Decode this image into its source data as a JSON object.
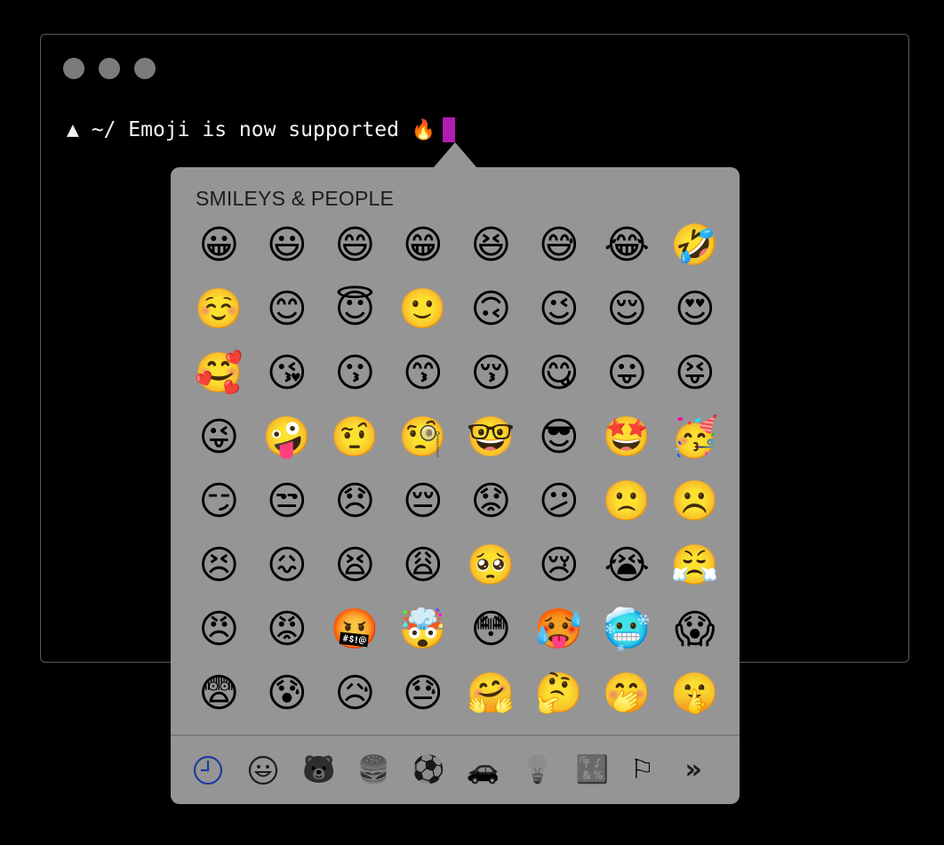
{
  "terminal": {
    "prompt_symbol": "▲",
    "path": "~/",
    "text": "Emoji is now supported",
    "text_emoji": "🔥",
    "cursor_color": "#b21cb3"
  },
  "picker": {
    "section_title": "SMILEYS & PEOPLE",
    "emojis": [
      "😀",
      "😃",
      "😄",
      "😁",
      "😆",
      "😅",
      "😂",
      "🤣",
      "☺️",
      "😊",
      "😇",
      "🙂",
      "🙃",
      "😉",
      "😌",
      "😍",
      "🥰",
      "😘",
      "😗",
      "😙",
      "😚",
      "😋",
      "😛",
      "😝",
      "😜",
      "🤪",
      "🤨",
      "🧐",
      "🤓",
      "😎",
      "🤩",
      "🥳",
      "😏",
      "😒",
      "😞",
      "😔",
      "😟",
      "😕",
      "🙁",
      "☹️",
      "😣",
      "😖",
      "😫",
      "😩",
      "🥺",
      "😢",
      "😭",
      "😤",
      "😠",
      "😡",
      "🤬",
      "🤯",
      "😳",
      "🥵",
      "🥶",
      "😱",
      "😨",
      "😰",
      "😥",
      "😓",
      "🤗",
      "🤔",
      "🤭",
      "🤫"
    ],
    "tabs": [
      {
        "name": "recent",
        "icon": "clock-icon",
        "glyph": ""
      },
      {
        "name": "smileys",
        "icon": "smiley-icon",
        "glyph": "☺"
      },
      {
        "name": "animals",
        "icon": "bear-icon",
        "glyph": "🐻"
      },
      {
        "name": "food",
        "icon": "food-icon",
        "glyph": "🍔"
      },
      {
        "name": "activity",
        "icon": "ball-icon",
        "glyph": "⚽"
      },
      {
        "name": "travel",
        "icon": "car-icon",
        "glyph": "🚗"
      },
      {
        "name": "objects",
        "icon": "lightbulb-icon",
        "glyph": "💡"
      },
      {
        "name": "symbols",
        "icon": "symbols-icon",
        "glyph": "🔣"
      },
      {
        "name": "flags",
        "icon": "flag-icon",
        "glyph": "⚐"
      },
      {
        "name": "more",
        "icon": "more-icon",
        "glyph": "»"
      }
    ],
    "colors": {
      "background": "#959595",
      "active_tab": "#1f3c9e"
    }
  }
}
